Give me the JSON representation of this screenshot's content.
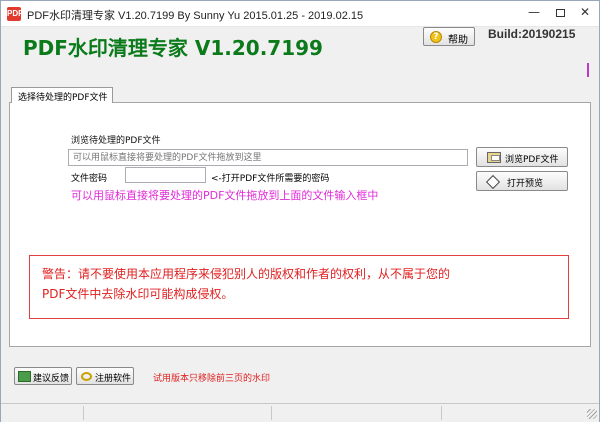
{
  "window": {
    "title": "PDF水印清理专家 V1.20.7199 By Sunny Yu 2015.01.25 - 2019.02.15",
    "app_icon_text": "PDF",
    "min_glyph": "—",
    "close_glyph": "✕"
  },
  "header": {
    "app_title": "PDF水印清理专家 V1.20.7199",
    "help_label": "帮助",
    "help_icon_glyph": "?",
    "build": "Build:20190215"
  },
  "tabs": [
    {
      "label": "选择待处理的PDF文件",
      "selected": true
    }
  ],
  "form": {
    "browse_label": "浏览待处理的PDF文件",
    "path_placeholder": "可以用鼠标直接将要处理的PDF文件拖放到这里",
    "browse_button": "浏览PDF文件",
    "password_label": "文件密码",
    "password_value": "",
    "password_hint": "<-打开PDF文件所需要的密码",
    "preview_button": "打开预览",
    "drag_tip": "可以用鼠标直接将要处理的PDF文件拖放到上面的文件输入框中"
  },
  "warning": {
    "line1": "警告：请不要使用本应用程序来侵犯别人的版权和作者的权利，从不属于您的",
    "line2": "PDF文件中去除水印可能构成侵权。"
  },
  "bottom": {
    "feedback_button": "建议反馈",
    "register_button": "注册软件",
    "trial_note": "试用版本只移除前三页的水印"
  },
  "colors": {
    "title_green": "#0a7a1a",
    "tip_magenta": "#e02ad8",
    "warning_red": "#e02020"
  },
  "icons": {
    "help": "question-icon",
    "browse": "folder-open-icon",
    "preview": "preview-icon",
    "feedback": "feedback-icon",
    "register": "key-icon"
  }
}
